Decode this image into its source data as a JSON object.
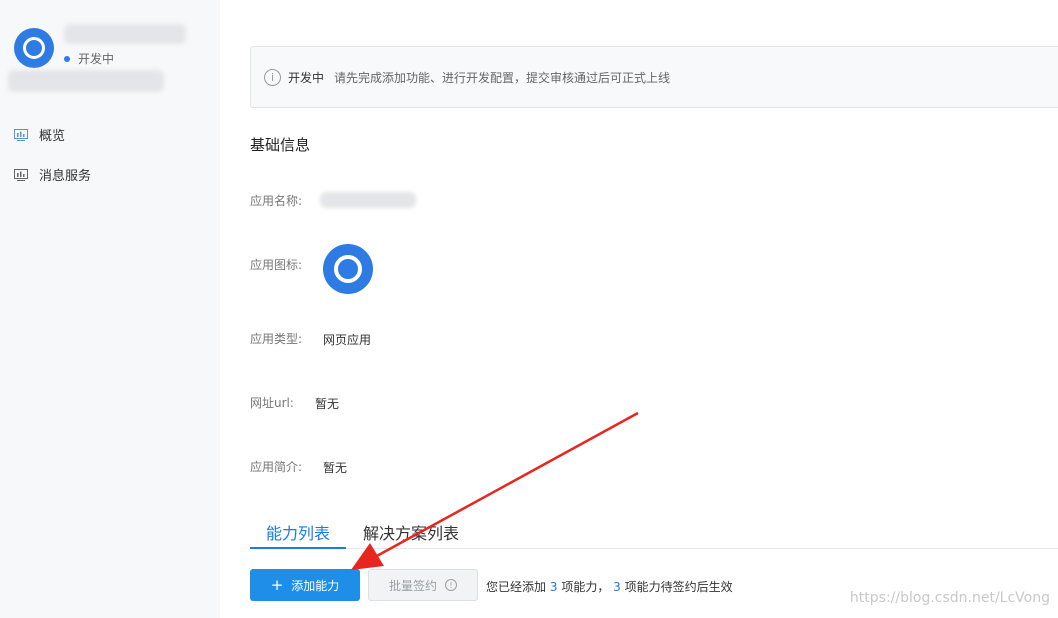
{
  "sidebar": {
    "status": "开发中",
    "items": [
      {
        "label": "概览",
        "icon": "dashboard-icon"
      },
      {
        "label": "消息服务",
        "icon": "message-service-icon"
      }
    ]
  },
  "alert": {
    "strong": "开发中",
    "text": "请先完成添加功能、进行开发配置，提交审核通过后可正式上线"
  },
  "basic_info": {
    "title": "基础信息",
    "name_label": "应用名称:",
    "icon_label": "应用图标:",
    "type_label": "应用类型:",
    "type_value": "网页应用",
    "url_label": "网址url:",
    "url_value": "暂无",
    "desc_label": "应用简介:",
    "desc_value": "暂无"
  },
  "tabs": [
    {
      "label": "能力列表",
      "active": true
    },
    {
      "label": "解决方案列表",
      "active": false
    }
  ],
  "actions": {
    "add_label": "添加能力",
    "batch_label": "批量签约"
  },
  "summary": {
    "part1": "您已经添加",
    "added": "3",
    "part2": "项能力，",
    "pending": "3",
    "part3": "项能力待签约后生效"
  },
  "watermark": "https://blog.csdn.net/LcVong",
  "colors": {
    "accent": "#1a7ce5",
    "primary_button": "#1f8ee8",
    "arrow": "#e8251f"
  }
}
